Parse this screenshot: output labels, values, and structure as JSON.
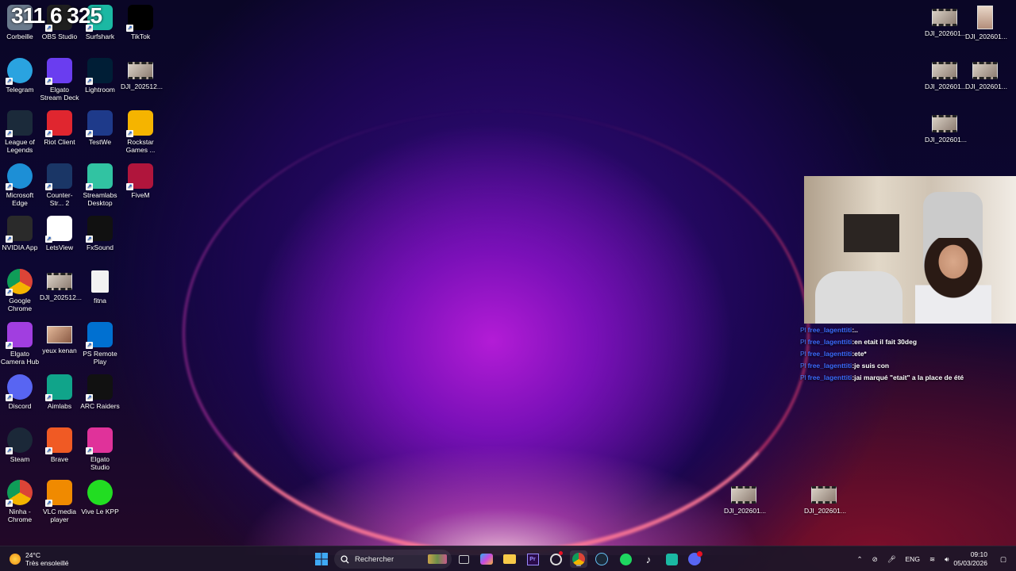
{
  "desktop": {
    "columns": [
      [
        {
          "label": "Corbeille",
          "icon": "recycle-bin-icon",
          "color": "#6a7a8c"
        },
        {
          "label": "Telegram",
          "icon": "telegram-icon",
          "color": "#2aa3e0"
        },
        {
          "label": "League of Legends",
          "icon": "league-of-legends-icon",
          "color": "#1b2a3a"
        },
        {
          "label": "Microsoft Edge",
          "icon": "edge-icon",
          "color": "#1d8fd6"
        },
        {
          "label": "NVIDIA App",
          "icon": "nvidia-icon",
          "color": "#2a2a2a"
        },
        {
          "label": "Google Chrome",
          "icon": "chrome-icon",
          "color": "#e8e8e8"
        },
        {
          "label": "Elgato Camera Hub",
          "icon": "elgato-camera-hub-icon",
          "color": "#a13ee0"
        },
        {
          "label": "Discord",
          "icon": "discord-icon",
          "color": "#5865f2"
        },
        {
          "label": "Steam",
          "icon": "steam-icon",
          "color": "#1b2838"
        },
        {
          "label": "Ninha - Chrome",
          "icon": "chrome-profile-icon",
          "color": "#e8e8e8"
        }
      ],
      [
        {
          "label": "OBS Studio",
          "icon": "obs-icon",
          "color": "#1f1f1f"
        },
        {
          "label": "Elgato Stream Deck",
          "icon": "stream-deck-icon",
          "color": "#6a3df0"
        },
        {
          "label": "Riot Client",
          "icon": "riot-client-icon",
          "color": "#e0262f"
        },
        {
          "label": "Counter-Str... 2",
          "icon": "counter-strike-icon",
          "color": "#1a3666"
        },
        {
          "label": "LetsView",
          "icon": "letsview-icon",
          "color": "#ffffff"
        },
        {
          "label": "DJI_202512...",
          "icon": "video-file-icon",
          "color": "#c8b8a8"
        },
        {
          "label": "yeux kenan",
          "icon": "image-file-icon",
          "color": "#c08060"
        },
        {
          "label": "Aimlabs",
          "icon": "aimlabs-icon",
          "color": "#10a48a"
        },
        {
          "label": "Brave",
          "icon": "brave-icon",
          "color": "#f05a24"
        },
        {
          "label": "VLC media player",
          "icon": "vlc-icon",
          "color": "#f08a00"
        }
      ],
      [
        {
          "label": "Surfshark",
          "icon": "surfshark-icon",
          "color": "#1bb8a3"
        },
        {
          "label": "Lightroom",
          "icon": "lightroom-icon",
          "color": "#001e36"
        },
        {
          "label": "TestWe",
          "icon": "testwe-icon",
          "color": "#1e3a8a"
        },
        {
          "label": "Streamlabs Desktop",
          "icon": "streamlabs-icon",
          "color": "#31c3a2"
        },
        {
          "label": "FxSound",
          "icon": "fxsound-icon",
          "color": "#111111"
        },
        {
          "label": "fitna",
          "icon": "text-file-icon",
          "color": "#f2f2f2"
        },
        {
          "label": "PS Remote Play",
          "icon": "ps-remote-play-icon",
          "color": "#0070d1"
        },
        {
          "label": "ARC Raiders",
          "icon": "arc-raiders-icon",
          "color": "#111111"
        },
        {
          "label": "Elgato Studio",
          "icon": "elgato-studio-icon",
          "color": "#e0329a"
        },
        {
          "label": "Vive Le KPP",
          "icon": "green-circle-icon",
          "color": "#22dd22"
        }
      ],
      [
        {
          "label": "TikTok",
          "icon": "tiktok-icon",
          "color": "#000000"
        },
        {
          "label": "DJI_202512...",
          "icon": "video-file-icon",
          "color": "#c8b8a8"
        },
        {
          "label": "Rockstar Games ...",
          "icon": "rockstar-icon",
          "color": "#f5b400"
        },
        {
          "label": "FiveM",
          "icon": "fivem-icon",
          "color": "#b0153c"
        }
      ]
    ],
    "overlay_digits": "311 6 325",
    "right_files": [
      {
        "label": "DJI_202601..."
      },
      {
        "label": "DJI_202601..."
      },
      {
        "label": "DJI_202601..."
      },
      {
        "label": "DJI_202601..."
      },
      {
        "label": "DJI_202601..."
      }
    ],
    "bottom_files": [
      {
        "label": "DJI_202601..."
      },
      {
        "label": "DJI_202601..."
      }
    ]
  },
  "chat": {
    "messages": [
      {
        "user": "free_lagenttiti",
        "text": ":.."
      },
      {
        "user": "free_lagenttiti",
        "text": ":en etait il fait 30deg"
      },
      {
        "user": "free_lagenttiti",
        "text": ":ete*"
      },
      {
        "user": "free_lagenttiti",
        "text": ":je suis con"
      },
      {
        "user": "free_lagenttiti",
        "text": ":jai marqué \"etait\" a la place de été"
      }
    ]
  },
  "taskbar": {
    "weather": {
      "temp": "24°C",
      "desc": "Très ensoleillé"
    },
    "search_placeholder": "Rechercher",
    "language": "ENG",
    "time": "09:10",
    "date": "05/03/2026"
  }
}
